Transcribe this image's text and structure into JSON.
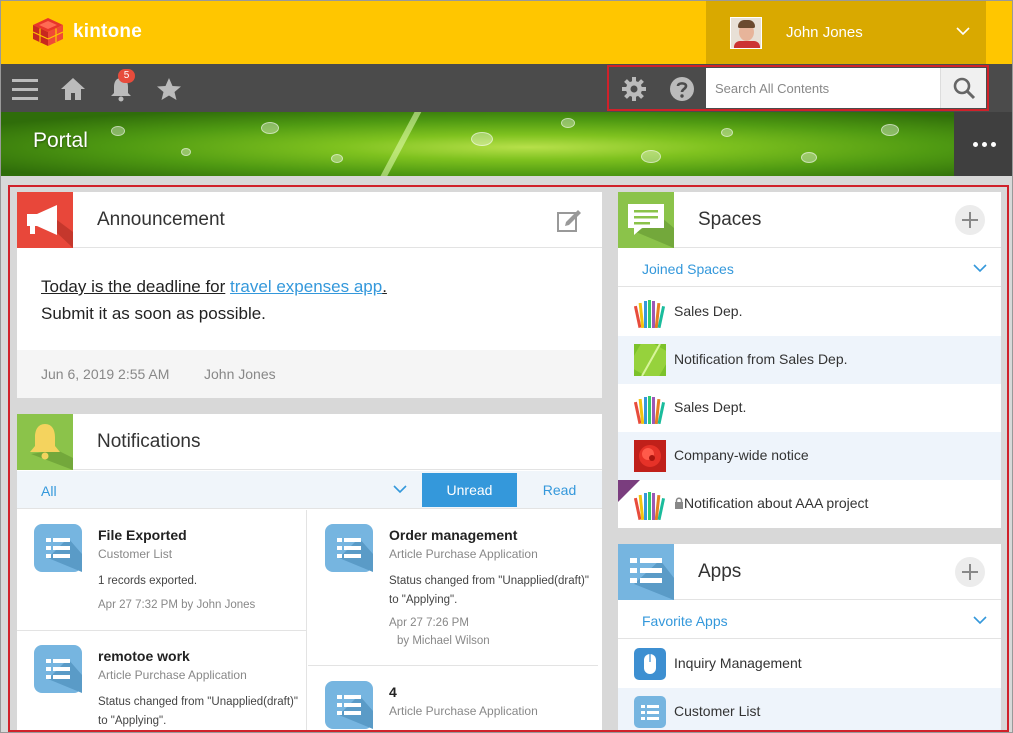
{
  "header": {
    "logo_text": "kintone",
    "user_name": "John Jones",
    "brand_color": "#ffc600"
  },
  "navbar": {
    "notification_count": "5",
    "search_placeholder": "Search All Contents"
  },
  "banner": {
    "title": "Portal"
  },
  "announcement": {
    "title": "Announcement",
    "text_prefix": "Today is the deadline for",
    "link_text": "travel expenses app",
    "text_suffix": ".",
    "line2": "Submit it as soon as possible.",
    "date": "Jun 6, 2019 2:55 AM",
    "author": "John Jones"
  },
  "notifications": {
    "title": "Notifications",
    "filter": "All",
    "tab_unread": "Unread",
    "tab_read": "Read",
    "items": [
      {
        "title": "File Exported",
        "app": "Customer List",
        "message": "1 records exported.",
        "meta": "Apr 27 7:32 PM  by John Jones"
      },
      {
        "title": "Order management",
        "app": "Article Purchase Application",
        "message": "Status changed from \"Unapplied(draft)\" to \"Applying\".",
        "meta_time": "Apr 27 7:26 PM",
        "meta_by": "by Michael Wilson"
      },
      {
        "title": "remotoe work",
        "app": "Article Purchase Application",
        "message": "Status changed from \"Unapplied(draft)\" to \"Applying\"."
      },
      {
        "title": "4",
        "app": "Article Purchase Application"
      }
    ]
  },
  "spaces": {
    "title": "Spaces",
    "section": "Joined Spaces",
    "items": [
      {
        "label": "Sales Dep.",
        "thumb": "pencils"
      },
      {
        "label": "Notification from Sales Dep.",
        "thumb": "green-leaf"
      },
      {
        "label": "Sales Dept.",
        "thumb": "pencils"
      },
      {
        "label": "Company-wide notice",
        "thumb": "red-flower"
      },
      {
        "label": "Notification about AAA project",
        "thumb": "pencils",
        "private": true
      }
    ]
  },
  "apps": {
    "title": "Apps",
    "section": "Favorite Apps",
    "items": [
      {
        "label": "Inquiry Management",
        "icon": "mouse-icon"
      },
      {
        "label": "Customer List",
        "icon": "list-icon"
      }
    ]
  }
}
